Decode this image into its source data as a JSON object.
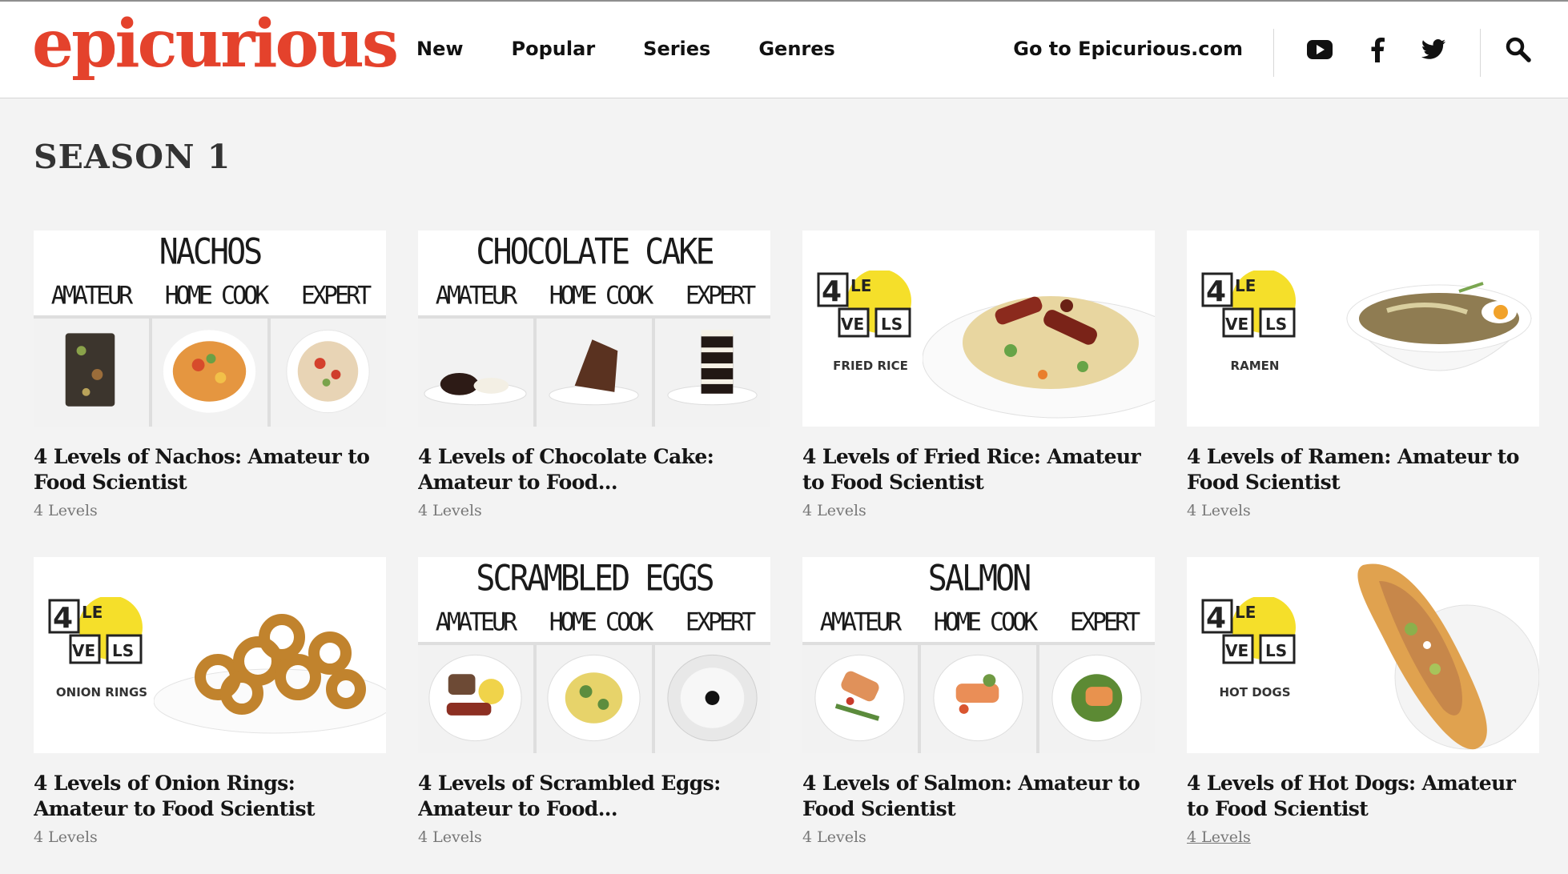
{
  "header": {
    "logo": "epicurious",
    "nav": [
      "New",
      "Popular",
      "Series",
      "Genres"
    ],
    "goto_label": "Go to Epicurious.com",
    "icons": [
      "youtube-icon",
      "facebook-icon",
      "twitter-icon",
      "search-icon"
    ]
  },
  "season_title": "SEASON 1",
  "cards": [
    {
      "title": "4 Levels of Nachos: Amateur to Food Scientist",
      "meta": "4 Levels",
      "thumb": {
        "style": "triptych",
        "heading": "NACHOS",
        "labels": [
          "AMATEUR",
          "HOME COOK",
          "EXPERT"
        ]
      }
    },
    {
      "title": "4 Levels of Chocolate Cake: Amateur to Food...",
      "meta": "4 Levels",
      "thumb": {
        "style": "triptych",
        "heading": "CHOCOLATE CAKE",
        "labels": [
          "AMATEUR",
          "HOME COOK",
          "EXPERT"
        ]
      }
    },
    {
      "title": "4 Levels of Fried Rice: Amateur to Food Scientist",
      "meta": "4 Levels",
      "thumb": {
        "style": "logo",
        "logo_text": "4 LEVELS",
        "caption": "FRIED RICE"
      }
    },
    {
      "title": "4 Levels of Ramen: Amateur to Food Scientist",
      "meta": "4 Levels",
      "thumb": {
        "style": "logo",
        "logo_text": "4 LEVELS",
        "caption": "RAMEN"
      }
    },
    {
      "title": "4 Levels of Onion Rings: Amateur to Food Scientist",
      "meta": "4 Levels",
      "thumb": {
        "style": "logo",
        "logo_text": "4 LEVELS",
        "caption": "ONION RINGS"
      }
    },
    {
      "title": "4 Levels of Scrambled Eggs: Amateur to Food...",
      "meta": "4 Levels",
      "thumb": {
        "style": "triptych",
        "heading": "SCRAMBLED EGGS",
        "labels": [
          "AMATEUR",
          "HOME COOK",
          "EXPERT"
        ]
      }
    },
    {
      "title": "4 Levels of Salmon: Amateur to Food Scientist",
      "meta": "4 Levels",
      "thumb": {
        "style": "triptych",
        "heading": "SALMON",
        "labels": [
          "AMATEUR",
          "HOME COOK",
          "EXPERT"
        ]
      }
    },
    {
      "title": "4 Levels of Hot Dogs: Amateur to Food Scientist",
      "meta": "4 Levels",
      "thumb": {
        "style": "logo",
        "logo_text": "4 LEVELS",
        "caption": "HOT DOGS"
      }
    }
  ],
  "colors": {
    "brand": "#e4422c",
    "logo_yellow": "#f5df2a",
    "background": "#f3f3f3"
  }
}
